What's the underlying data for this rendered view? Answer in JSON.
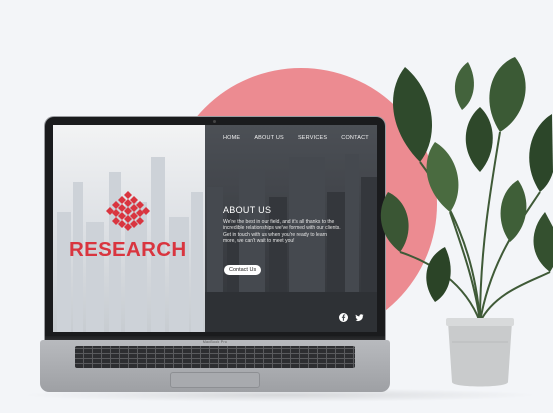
{
  "laptop": {
    "brand": "MacBook Pro"
  },
  "website": {
    "nav": {
      "items": [
        "HOME",
        "ABOUT US",
        "SERVICES",
        "CONTACT"
      ]
    },
    "logo_text": "RESEARCH",
    "about": {
      "title": "ABOUT US",
      "body": "We're the best in our field, and it's all thanks to the incredible relationships we've formed with our clients. Get in touch with us when you're ready to learn more, we can't wait to meet you!",
      "button_label": "Contact Us"
    },
    "social": {
      "icons": [
        "facebook-icon",
        "twitter-icon"
      ]
    }
  },
  "colors": {
    "accent_circle": "#ec8b91",
    "logo_red": "#d9353f",
    "background": "#f3f5f8"
  }
}
